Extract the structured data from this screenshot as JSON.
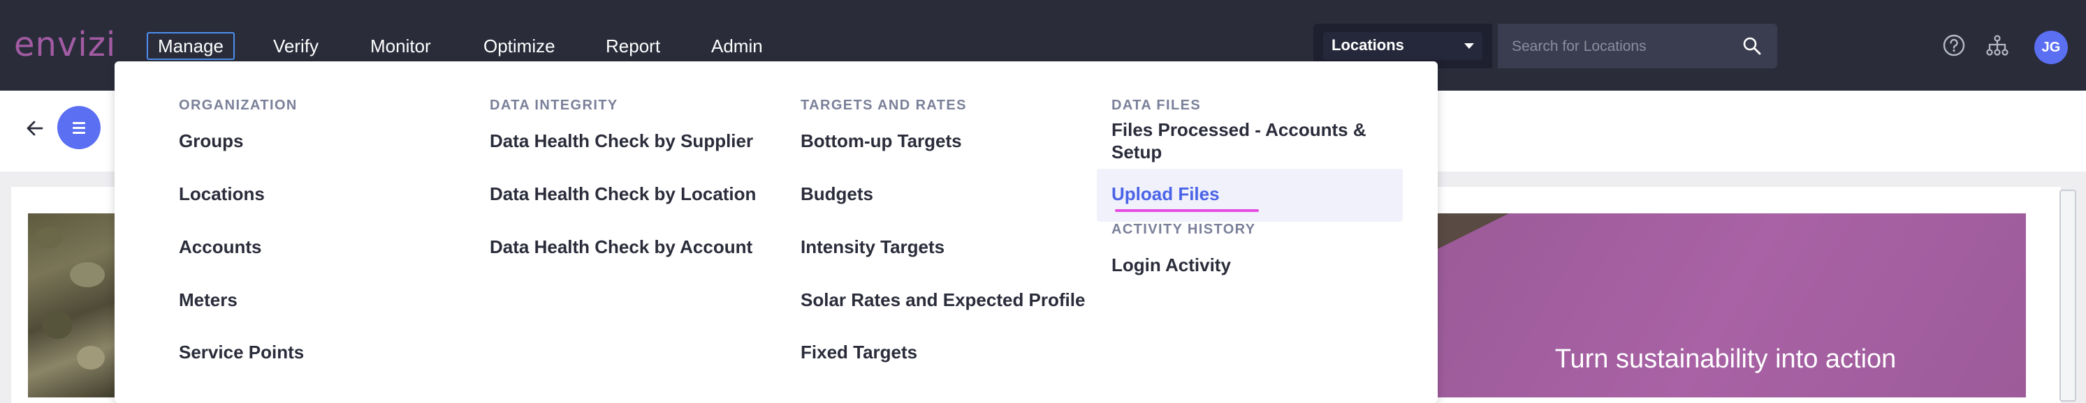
{
  "app": {
    "logo": "envizi"
  },
  "nav": {
    "items": [
      {
        "label": "Manage"
      },
      {
        "label": "Verify"
      },
      {
        "label": "Monitor"
      },
      {
        "label": "Optimize"
      },
      {
        "label": "Report"
      },
      {
        "label": "Admin"
      }
    ],
    "active": "Manage"
  },
  "location_select": {
    "selected": "Locations"
  },
  "search": {
    "placeholder": "Search for Locations"
  },
  "user": {
    "initials": "JG"
  },
  "dropdown": {
    "columns": [
      {
        "heading": "ORGANIZATION",
        "items": [
          "Groups",
          "Locations",
          "Accounts",
          "Meters",
          "Service Points"
        ]
      },
      {
        "heading": "DATA INTEGRITY",
        "items": [
          "Data Health Check by Supplier",
          "Data Health Check by Location",
          "Data Health Check by Account"
        ]
      },
      {
        "heading": "TARGETS AND RATES",
        "items": [
          "Bottom-up Targets",
          "Budgets",
          "Intensity Targets",
          "Solar Rates and Expected Profile",
          "Fixed Targets"
        ]
      },
      {
        "heading": "DATA FILES",
        "items": [
          "Files Processed - Accounts &",
          "Setup",
          "Upload Files"
        ],
        "selected": "Upload Files"
      },
      {
        "heading": "ACTIVITY HISTORY",
        "items": [
          "Login Activity"
        ]
      }
    ]
  },
  "hero": {
    "title": "Turn sustainability into action"
  },
  "colors": {
    "nav_bg": "#2a2c3a",
    "accent": "#5a6ff2",
    "brand": "#a35ba3",
    "highlight": "#e34de1",
    "link_selected": "#4a63e7"
  }
}
